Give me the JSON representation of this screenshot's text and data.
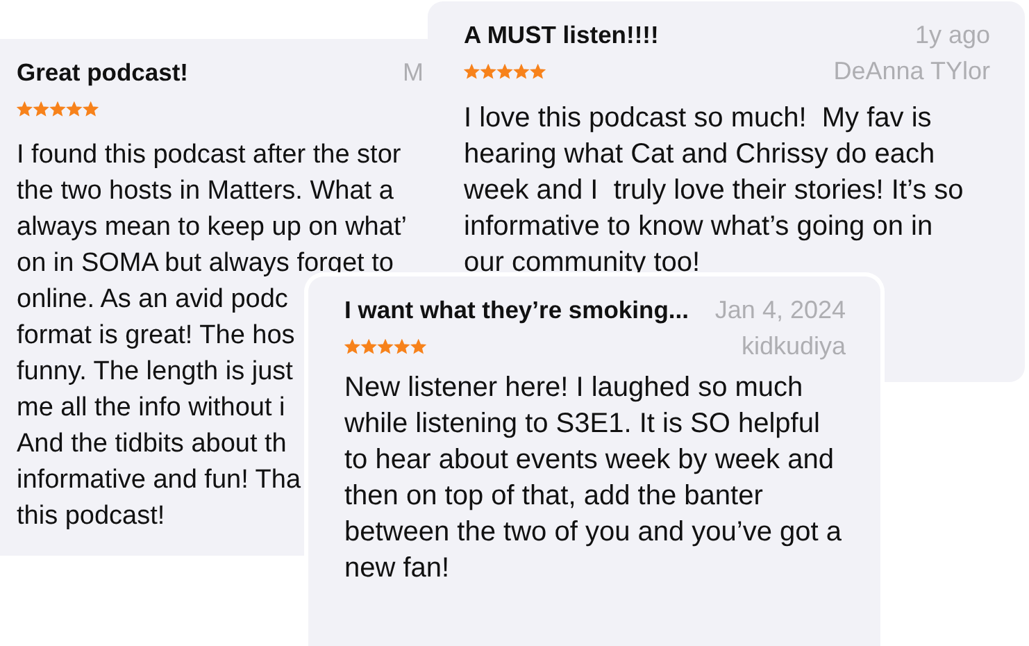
{
  "reviews": [
    {
      "title": "Great podcast!",
      "stars": 5,
      "date": "M",
      "body_lines": [
        "I found this podcast after the stor",
        "the two hosts in Matters. What a",
        "always mean to keep up on what’",
        "on in SOMA but always forget to",
        "online. As an avid podc",
        "format is great! The hos",
        "funny. The length is just",
        "me all the info without i",
        "And the tidbits about th",
        "informative and fun! Tha",
        "this podcast!"
      ]
    },
    {
      "title": "A MUST listen!!!!",
      "stars": 5,
      "date": "1y ago",
      "author": "DeAnna TYlor",
      "body": "I love this podcast so much!  My fav is hearing what Cat and Chrissy do each week and I  truly love their stories! It’s so informative to know what’s going on in our community too!"
    },
    {
      "title": "I want what they’re smoking...",
      "stars": 5,
      "date": "Jan 4, 2024",
      "author": "kidkudiya",
      "body": "New listener here! I laughed so much while listening to S3E1. It is SO helpful to hear about events week by week and then on top of that, add the banter between the two of you and you’ve got a new fan!"
    }
  ]
}
